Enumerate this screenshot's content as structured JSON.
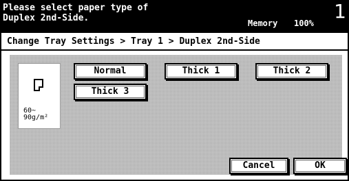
{
  "header": {
    "message_line1": "Please select paper type of",
    "message_line2": "Duplex 2nd-Side.",
    "memory_label": "Memory",
    "memory_value": "100%",
    "page_number": "1"
  },
  "breadcrumb": {
    "text": "Change Tray Settings > Tray 1 > Duplex 2nd-Side"
  },
  "tray": {
    "icon": "paper-icon",
    "weight_line1": "60~",
    "weight_line2": "90g/m²"
  },
  "paper_types": {
    "normal": "Normal",
    "thick1": "Thick 1",
    "thick2": "Thick 2",
    "thick3": "Thick 3"
  },
  "footer": {
    "cancel_label": "Cancel",
    "ok_label": "OK"
  }
}
